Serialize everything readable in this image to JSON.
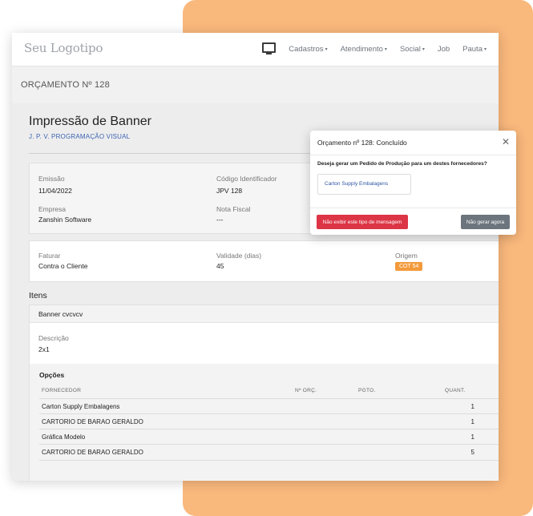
{
  "nav": {
    "logo": "Seu Logotipo",
    "items": [
      {
        "label": "Cadastros",
        "dropdown": true
      },
      {
        "label": "Atendimento",
        "dropdown": true
      },
      {
        "label": "Social",
        "dropdown": true
      },
      {
        "label": "Job",
        "dropdown": false
      },
      {
        "label": "Pauta",
        "dropdown": true
      }
    ],
    "icon": "monitor-icon",
    "caret": "▾"
  },
  "page": {
    "header": "ORÇAMENTO Nº 128"
  },
  "doc": {
    "title": "Impressão de Banner",
    "client": "J. P. V. PROGRAMAÇÃO VISUAL",
    "fields1": {
      "emissao_label": "Emissão",
      "emissao_value": "11/04/2022",
      "codigo_label": "Código Identificador",
      "codigo_value": "JPV 128",
      "empresa_label": "Empresa",
      "empresa_value": "Zanshin Software",
      "nota_label": "Nota Fiscal",
      "nota_value": "---"
    },
    "fields2": {
      "faturar_label": "Faturar",
      "faturar_value": "Contra o Cliente",
      "validade_label": "Validade (dias)",
      "validade_value": "45",
      "origem_label": "Origem",
      "origem_badge": "COT 54"
    },
    "origem_badge_color": "#f39a3b"
  },
  "items": {
    "heading": "Itens",
    "name": "Banner cvcvcv",
    "desc_label": "Descrição",
    "desc_value": "2x1",
    "options_title": "Opções",
    "columns": [
      "FORNECEDOR",
      "Nº ORÇ.",
      "PGTO.",
      "QUANT."
    ],
    "rows": [
      {
        "supplier": "Carton Supply Embalagens",
        "orc": "",
        "pgto": "",
        "qty": "1"
      },
      {
        "supplier": "CARTORIO DE BARAO GERALDO",
        "orc": "",
        "pgto": "",
        "qty": "1"
      },
      {
        "supplier": "Gráfica Modelo",
        "orc": "",
        "pgto": "",
        "qty": "1"
      },
      {
        "supplier": "CARTORIO DE BARAO GERALDO",
        "orc": "",
        "pgto": "",
        "qty": "5"
      }
    ]
  },
  "modal": {
    "title": "Orçamento nº 128: Concluído",
    "close": "✕",
    "question": "Deseja gerar um Pedido de Produção para um destes fornecedores?",
    "supplier_option": "Carton Supply Embalagens",
    "btn_dont_show": "Não exibir este tipo de mensagem",
    "btn_not_now": "Não gerar agora",
    "colors": {
      "danger": "#dc3545",
      "secondary": "#6c757d"
    }
  }
}
